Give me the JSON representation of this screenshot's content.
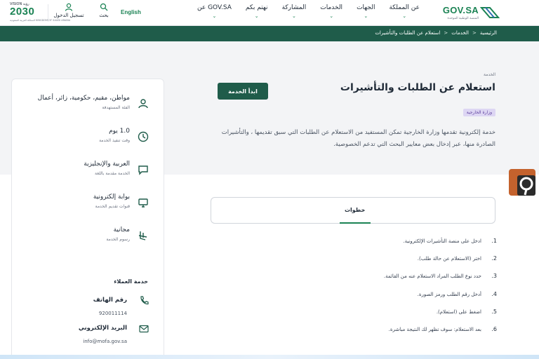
{
  "header": {
    "gov_logo": "GOV.SA",
    "gov_logo_sub": "المنصة الوطنية الموحدة",
    "nav": [
      {
        "label": "عن المملكة"
      },
      {
        "label": "الجهات"
      },
      {
        "label": "الخدمات"
      },
      {
        "label": "المشاركة"
      },
      {
        "label": "نهتم بكم"
      },
      {
        "label": "عن GOV.SA"
      }
    ],
    "language": "English",
    "search_label": "بحث",
    "login_label": "تسجيل الدخول",
    "vision": {
      "line1": "VISION رؤية",
      "year": "2030",
      "line3": "المملكة العربية السعودية KINGDOM OF SAUDI ARABIA"
    }
  },
  "breadcrumb": [
    "الرئيسية",
    "الخدمات",
    "استعلام عن الطلبات والتأشيرات"
  ],
  "breadcrumb_sep": ">",
  "service": {
    "type": "الخدمة",
    "title": "استعلام عن الطلبات والتأشيرات",
    "start_button": "ابدأ الخدمة",
    "agency_badge": "وزارة الخارجية",
    "description": "خدمة إلكترونية تقدمها وزارة الخارجية تمكن المستفيد من الاستعلام عن الطلبات التي سبق تقديمها ، والتأشيرات الصادرة منها، عبر إدخال بعض معايير البحث التي تدعم الخصوصية."
  },
  "info": [
    {
      "icon": "users-icon",
      "value": "مواطن، مقيم، حكومية، زائر، أعمال",
      "label": "الفئة المستهدفة"
    },
    {
      "icon": "clock-icon",
      "value": "1.0 يوم",
      "label": "وقت تنفيذ الخدمة"
    },
    {
      "icon": "chat-icon",
      "value": "العربية والإنجليزية",
      "label": "الخدمة مقدمة باللغة"
    },
    {
      "icon": "monitor-icon",
      "value": "بوابة إلكترونية",
      "label": "قنوات تقديم الخدمة"
    },
    {
      "icon": "riyal-icon",
      "value": "مجانية",
      "label": "رسوم الخدمة"
    }
  ],
  "customer_service": {
    "title": "خدمة العملاء",
    "phone_label": "رقم الهاتف",
    "phone": "920011114",
    "email_label": "البريد الإلكتروني",
    "email": "info@mofa.gov.sa"
  },
  "steps_tab": "خطوات",
  "steps": [
    {
      "num": "1.",
      "text": "ادخل على منصة التأشيرات الإلكترونية."
    },
    {
      "num": "2.",
      "text": "اختر (الاستعلام عن حالة طلب)."
    },
    {
      "num": "3.",
      "text": "حدد نوع الطلب المراد الاستعلام عنه من القائمة."
    },
    {
      "num": "4.",
      "text": "أدخل رقم الطلب ورمز الصورة."
    },
    {
      "num": "5.",
      "text": "اضغط على (استعلام)."
    },
    {
      "num": "6.",
      "text": "بعد الاستعلام: سوف تظهر لك النتيجة مباشرة."
    }
  ],
  "colors": {
    "brand": "#1b8354",
    "dark_green": "#1f5c4a",
    "badge_bg": "#ddd6f3"
  }
}
